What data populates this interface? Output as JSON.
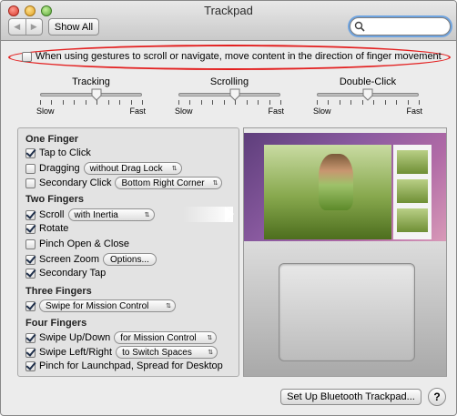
{
  "window": {
    "title": "Trackpad",
    "show_all_label": "Show All",
    "back_icon": "◀",
    "forward_icon": "▶",
    "search": {
      "value": "",
      "placeholder": ""
    }
  },
  "natural_scroll": {
    "label": "When using gestures to scroll or navigate, move content in the direction of finger movement",
    "checked": false,
    "highlight_color": "#e32020"
  },
  "sliders": [
    {
      "label": "Tracking",
      "min_label": "Slow",
      "max_label": "Fast",
      "value": 0.55
    },
    {
      "label": "Scrolling",
      "min_label": "Slow",
      "max_label": "Fast",
      "value": 0.55
    },
    {
      "label": "Double-Click",
      "min_label": "Slow",
      "max_label": "Fast",
      "value": 0.5
    }
  ],
  "gestures": {
    "one_finger": {
      "heading": "One Finger",
      "tap_to_click": {
        "label": "Tap to Click",
        "checked": true
      },
      "dragging": {
        "label": "Dragging",
        "checked": false,
        "popup": "without Drag Lock"
      },
      "secondary_click": {
        "label": "Secondary Click",
        "checked": false,
        "popup": "Bottom Right Corner"
      }
    },
    "two_fingers": {
      "heading": "Two Fingers",
      "scroll": {
        "label": "Scroll",
        "checked": true,
        "popup": "with Inertia"
      },
      "rotate": {
        "label": "Rotate",
        "checked": true
      },
      "pinch": {
        "label": "Pinch Open & Close",
        "checked": false
      },
      "screen_zoom": {
        "label": "Screen Zoom",
        "checked": true,
        "button": "Options..."
      },
      "secondary_tap": {
        "label": "Secondary Tap",
        "checked": true
      }
    },
    "three_fingers": {
      "heading": "Three Fingers",
      "swipe": {
        "checked": true,
        "popup": "Swipe for Mission Control"
      }
    },
    "four_fingers": {
      "heading": "Four Fingers",
      "swipe_up_down": {
        "label": "Swipe Up/Down",
        "checked": true,
        "popup": "for Mission Control"
      },
      "swipe_left_right": {
        "label": "Swipe Left/Right",
        "checked": true,
        "popup": "to Switch Spaces"
      },
      "pinch_launchpad": {
        "label": "Pinch for Launchpad, Spread for Desktop",
        "checked": true
      }
    }
  },
  "footer": {
    "bluetooth_button": "Set Up Bluetooth Trackpad...",
    "help_button": "?"
  },
  "icons": {
    "search": "search-icon",
    "popup_arrows": "⇅"
  }
}
